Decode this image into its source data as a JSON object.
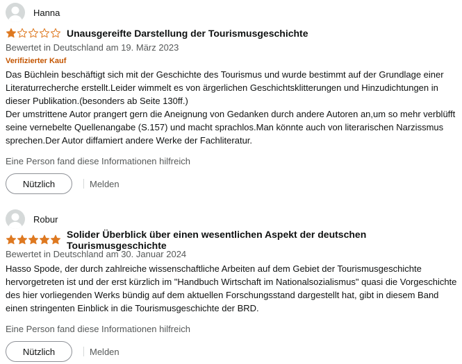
{
  "reviews": [
    {
      "author": "Hanna",
      "rating": 1,
      "max_rating": 5,
      "title": "Unausgereifte Darstellung der Tourismusgeschichte",
      "meta": "Bewertet in Deutschland am 19. März 2023",
      "verified": "Verifizierter Kauf",
      "body": [
        "Das Büchlein beschäftigt sich mit der Geschichte des Tourismus und wurde bestimmt auf der Grundlage einer Literaturrecherche erstellt.Leider wimmelt es von ärgerlichen Geschichtsklitterungen und Hinzudichtungen in dieser Publikation.(besonders ab Seite 130ff.)",
        "Der umstrittene Autor prangert gern die Aneignung von Gedanken durch andere Autoren an,um so mehr verblüfft seine vernebelte Quellenangabe (S.157) und macht sprachlos.Man könnte auch von literarischen Narzissmus sprechen.Der Autor diffamiert andere Werke der Fachliteratur."
      ],
      "helpful_text": "Eine Person fand diese Informationen hilfreich",
      "helpful_button": "Nützlich",
      "report_link": "Melden"
    },
    {
      "author": "Robur",
      "rating": 5,
      "max_rating": 5,
      "title": "Solider Überblick über einen wesentlichen Aspekt der deutschen Tourismusgeschichte",
      "meta": "Bewertet in Deutschland am 30. Januar 2024",
      "body": [
        "Hasso Spode, der durch zahlreiche wissenschaftliche Arbeiten auf dem Gebiet der Tourismusgeschichte hervorgetreten ist und der erst kürzlich im \"Handbuch Wirtschaft im Nationalsozialismus\" quasi die Vorgeschichte des hier vorliegenden Werks bündig auf dem aktuellen Forschungsstand dargestellt hat, gibt in diesem Band einen stringenten Einblick in die Tourismusgeschichte der BRD."
      ],
      "helpful_text": "Eine Person fand diese Informationen hilfreich",
      "helpful_button": "Nützlich",
      "report_link": "Melden"
    }
  ],
  "colors": {
    "star_filled": "#de7921",
    "verified": "#c45500",
    "meta": "#565959"
  },
  "icons": {
    "avatar": "default-user-avatar-icon",
    "star_filled": "filled-star-icon",
    "star_empty": "empty-star-icon"
  }
}
